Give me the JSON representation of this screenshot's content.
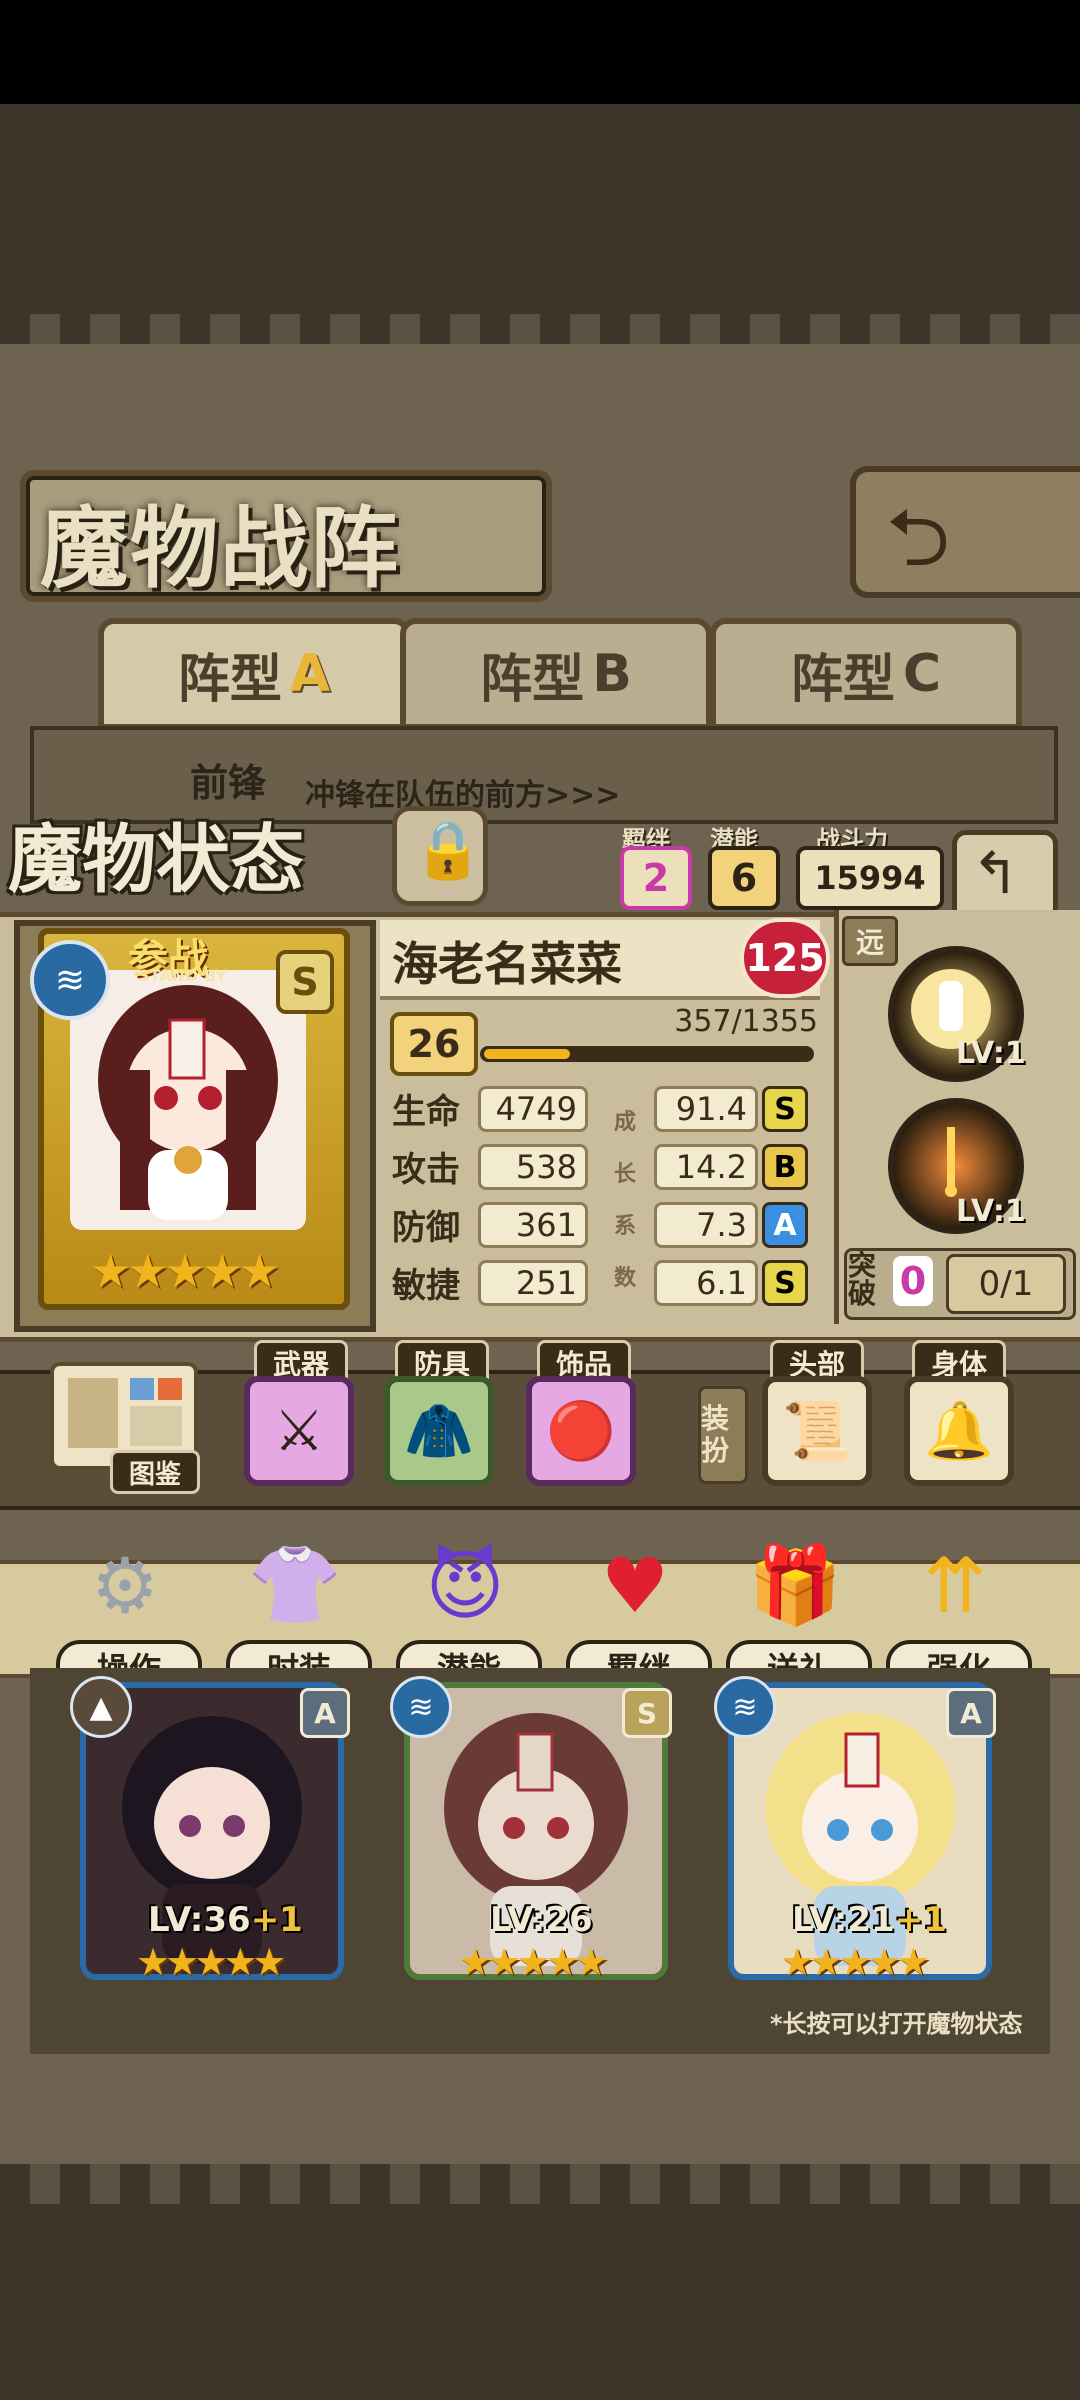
{
  "header": {
    "title": "魔物战阵",
    "back_icon": "return-arrow-icon"
  },
  "tabs": [
    {
      "label": "阵型",
      "suffix": "A",
      "active": true
    },
    {
      "label": "阵型",
      "suffix": "B",
      "active": false
    },
    {
      "label": "阵型",
      "suffix": "C",
      "active": false
    }
  ],
  "vanguard": {
    "title": "前锋",
    "desc": "冲锋在队伍的前方>>>"
  },
  "status": {
    "title": "魔物状态",
    "bond_label": "羁绊",
    "bond_value": "2",
    "potential_label": "潜能",
    "potential_value": "6",
    "power_label": "战斗力",
    "power_value": "15994"
  },
  "monster": {
    "name": "海老名菜菜",
    "affection": "125",
    "standby_label": "参战",
    "standby_sub": "STAND BY",
    "rank": "S",
    "stars": "★★★★★",
    "level": "26",
    "exp_text": "357/1355",
    "exp_fraction": 0.263,
    "range": "远",
    "stats": [
      {
        "label": "生命",
        "value": "4749",
        "growth": "91.4",
        "grade": "S"
      },
      {
        "label": "攻击",
        "value": "538",
        "growth": "14.2",
        "grade": "B"
      },
      {
        "label": "防御",
        "value": "361",
        "growth": "7.3",
        "grade": "A"
      },
      {
        "label": "敏捷",
        "value": "251",
        "growth": "6.1",
        "grade": "S"
      }
    ],
    "growth_chars": [
      "成",
      "长",
      "系",
      "数"
    ],
    "skills": [
      {
        "icon": "fist-sun-icon",
        "level": "LV:1"
      },
      {
        "icon": "flame-sword-icon",
        "level": "LV:1"
      }
    ],
    "breakthrough_label": "突破",
    "breakthrough_count": "0",
    "breakthrough_ratio": "0/1"
  },
  "equipment": {
    "book_label": "图鉴",
    "weapon_label": "武器",
    "armor_label": "防具",
    "accessory_label": "饰品",
    "dress_label": "装扮",
    "head_label": "头部",
    "body_label": "身体"
  },
  "actions": [
    {
      "label": "操作",
      "icon": "gear-icon"
    },
    {
      "label": "时装",
      "icon": "outfit-icon"
    },
    {
      "label": "潜能",
      "icon": "demon-icon"
    },
    {
      "label": "羁绊",
      "icon": "hearts-icon"
    },
    {
      "label": "送礼",
      "icon": "gift-icon"
    },
    {
      "label": "强化",
      "icon": "arrows-up-icon"
    }
  ],
  "roster": [
    {
      "level": "LV:36",
      "bonus": "+1",
      "rank": "A",
      "stars": "★★★★★"
    },
    {
      "level": "LV:26",
      "bonus": "",
      "rank": "S",
      "stars": "★★★★★"
    },
    {
      "level": "LV:21",
      "bonus": "+1",
      "rank": "A",
      "stars": "★★★★★"
    }
  ],
  "hint": "*长按可以打开魔物状态",
  "colors": {
    "gold": "#f2b41c",
    "grade_S": "#e8d64a",
    "grade_B": "#e8c74a",
    "grade_A": "#3a8fe0",
    "pink": "#c83aa8"
  }
}
